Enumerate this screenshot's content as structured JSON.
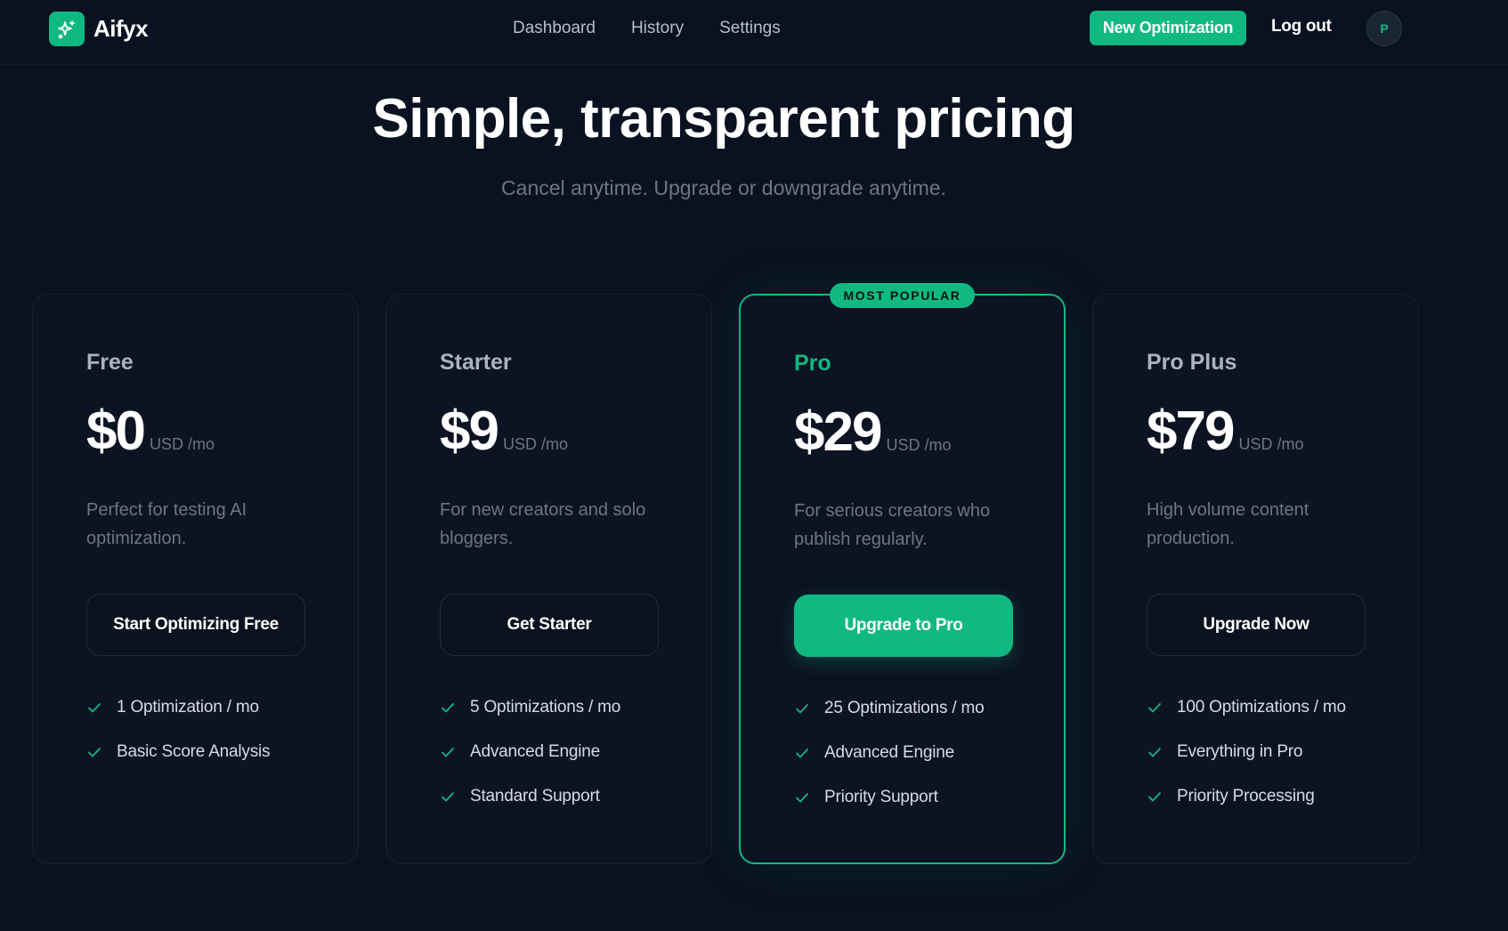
{
  "brand": {
    "name": "Aifyx",
    "icon": "sparkles-icon",
    "accent": "#10b981"
  },
  "nav": {
    "items": [
      "Dashboard",
      "History",
      "Settings"
    ]
  },
  "header": {
    "new_optimization": "New Optimization",
    "logout": "Log out",
    "avatar_initial": "P"
  },
  "hero": {
    "title": "Simple, transparent pricing",
    "subtitle": "Cancel anytime. Upgrade or downgrade anytime."
  },
  "plans": [
    {
      "name": "Free",
      "price": "$0",
      "unit": "USD /mo",
      "description": "Perfect for testing AI optimization.",
      "cta": "Start Optimizing Free",
      "features": [
        "1 Optimization / mo",
        "Basic Score Analysis"
      ]
    },
    {
      "name": "Starter",
      "price": "$9",
      "unit": "USD /mo",
      "description": "For new creators and solo bloggers.",
      "cta": "Get Starter",
      "features": [
        "5 Optimizations / mo",
        "Advanced Engine",
        "Standard Support"
      ]
    },
    {
      "name": "Pro",
      "price": "$29",
      "unit": "USD /mo",
      "badge": "MOST POPULAR",
      "description": "For serious creators who publish regularly.",
      "cta": "Upgrade to Pro",
      "features": [
        "25 Optimizations / mo",
        "Advanced Engine",
        "Priority Support"
      ]
    },
    {
      "name": "Pro Plus",
      "price": "$79",
      "unit": "USD /mo",
      "description": "High volume content production.",
      "cta": "Upgrade Now",
      "features": [
        "100 Optimizations / mo",
        "Everything in Pro",
        "Priority Processing"
      ]
    }
  ]
}
